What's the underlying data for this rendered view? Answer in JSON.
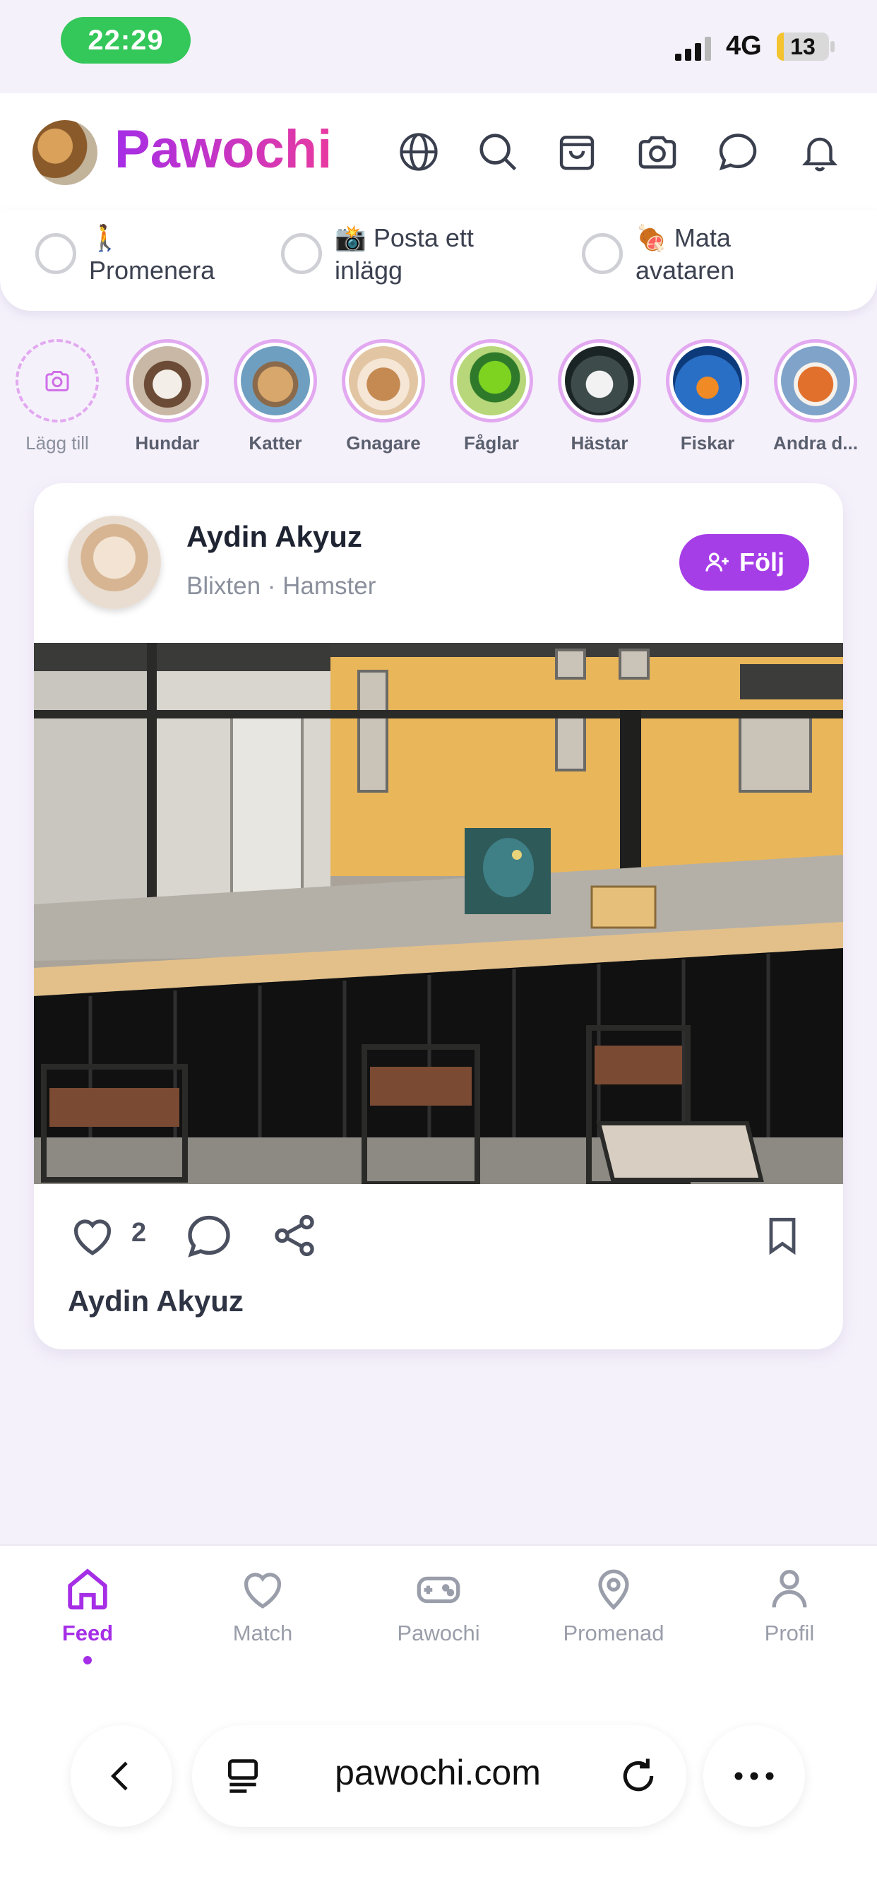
{
  "status_bar": {
    "time": "22:29",
    "network": "4G",
    "battery": "13",
    "battery_level": 0.13
  },
  "header": {
    "brand": "Pawochi",
    "icons": [
      "globe-icon",
      "search-icon",
      "shopping-bag-icon",
      "camera-icon",
      "chat-icon",
      "bell-icon"
    ]
  },
  "tasks": [
    {
      "emoji": "🚶",
      "label": "Promenera",
      "checked": false
    },
    {
      "emoji": "📸",
      "label": "Posta ett inlägg",
      "checked": false
    },
    {
      "emoji": "🍖",
      "label": "Mata avataren",
      "checked": false
    }
  ],
  "categories": {
    "add_label": "Lägg till",
    "items": [
      {
        "label": "Hundar",
        "color": "#c9b8a6"
      },
      {
        "label": "Katter",
        "color": "#6f9fc0"
      },
      {
        "label": "Gnagare",
        "color": "#e2c6a3"
      },
      {
        "label": "Fåglar",
        "color": "#6fbf4a"
      },
      {
        "label": "Hästar",
        "color": "#2c3a3a"
      },
      {
        "label": "Fiskar",
        "color": "#2f6fbf"
      },
      {
        "label": "Andra d...",
        "color": "#d9692c"
      }
    ]
  },
  "post": {
    "author": "Aydin Akyuz",
    "subtitle": "Blixten · Hamster",
    "follow_label": "Följ",
    "likes": "2",
    "caption_name": "Aydin Akyuz"
  },
  "bottom_nav": [
    {
      "label": "Feed",
      "icon": "home-icon",
      "active": true
    },
    {
      "label": "Match",
      "icon": "heart-icon",
      "active": false
    },
    {
      "label": "Pawochi",
      "icon": "gamepad-icon",
      "active": false
    },
    {
      "label": "Promenad",
      "icon": "location-pin-icon",
      "active": false
    },
    {
      "label": "Profil",
      "icon": "person-icon",
      "active": false
    }
  ],
  "browser": {
    "url": "pawochi.com"
  },
  "colors": {
    "accent": "#a52ee6",
    "accent_pink": "#e83aa0",
    "status_green": "#34c759"
  }
}
